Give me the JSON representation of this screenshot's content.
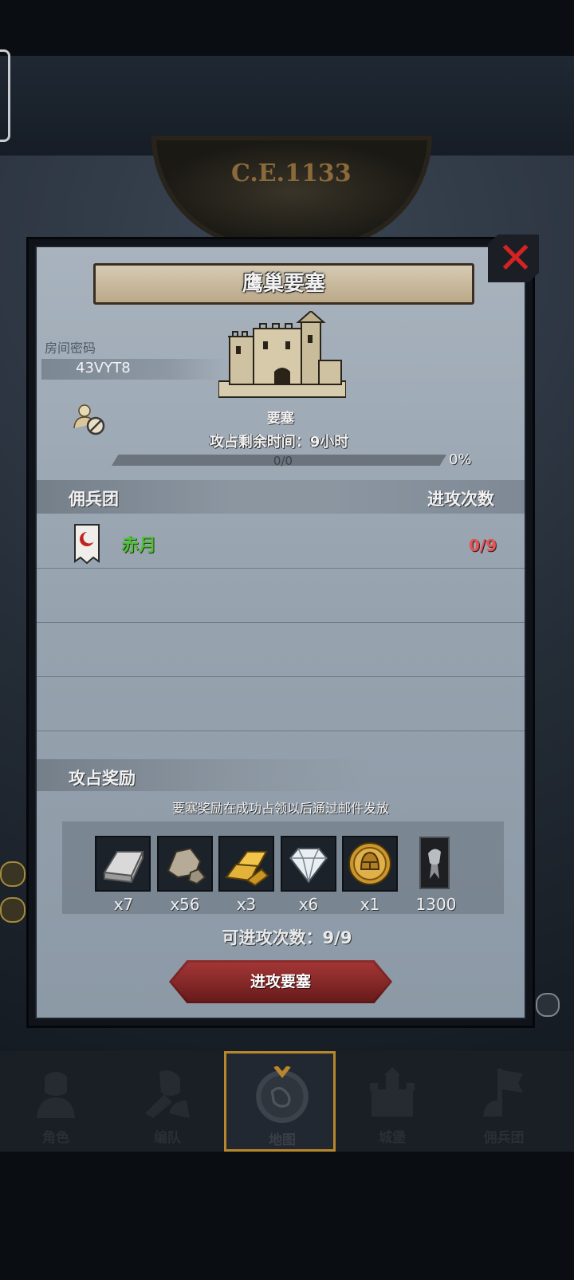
{
  "header": {
    "year": "C.E.1133"
  },
  "dialog": {
    "title": "鹰巢要塞",
    "room": {
      "label": "房间密码",
      "code": "43VYT8"
    },
    "fortress": {
      "type_label": "要塞",
      "time_remaining": "攻占剩余时间：9小时",
      "progress_count": "0/0",
      "progress_percent": "0%",
      "progress_fraction": 0
    },
    "table": {
      "col_mercenary": "佣兵团",
      "col_attacks": "进攻次数",
      "rows": [
        {
          "name": "赤月",
          "attacks": "0/9"
        }
      ]
    },
    "rewards": {
      "header": "攻占奖励",
      "note": "要塞奖励在成功占领以后通过邮件发放",
      "items": [
        {
          "icon": "iron-ingot-icon",
          "count": "x7"
        },
        {
          "icon": "stone-ore-icon",
          "count": "x56"
        },
        {
          "icon": "gold-bars-icon",
          "count": "x3"
        },
        {
          "icon": "diamond-icon",
          "count": "x6"
        },
        {
          "icon": "knight-helmet-medal-icon",
          "count": "x1"
        },
        {
          "icon": "fame-banner-icon",
          "count": "1300"
        }
      ]
    },
    "remaining_attacks": "可进攻次数：9/9",
    "attack_button": "进攻要塞"
  },
  "nav": {
    "items": [
      {
        "label": "角色",
        "icon": "character-icon"
      },
      {
        "label": "编队",
        "icon": "formation-icon"
      },
      {
        "label": "地图",
        "icon": "map-icon"
      },
      {
        "label": "城堡",
        "icon": "castle-icon"
      },
      {
        "label": "佣兵团",
        "icon": "mercenary-icon"
      }
    ]
  }
}
